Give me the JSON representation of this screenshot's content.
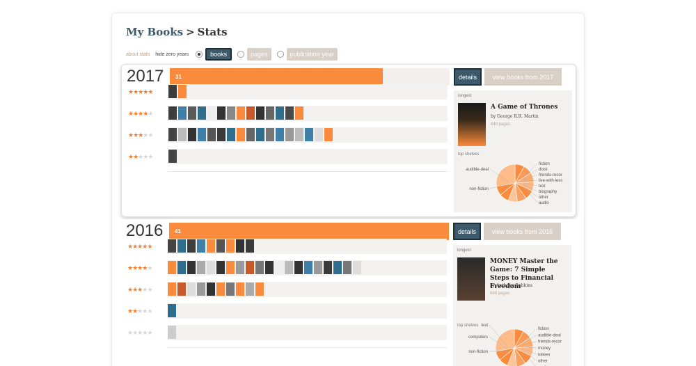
{
  "header": {
    "title_part1": "My Books",
    "title_sep": ">",
    "title_part2": "Stats"
  },
  "controls": {
    "about": "about stats",
    "hide": "hide zero years",
    "toggles": [
      {
        "label": "books",
        "selected": true
      },
      {
        "label": "pages",
        "selected": false
      },
      {
        "label": "publication year",
        "selected": false
      }
    ]
  },
  "colors": {
    "accent": "#fa8b3c",
    "nav": "#3d5a6b",
    "muted": "#d8cfc6"
  },
  "years": [
    {
      "year": "2017",
      "count": "31",
      "fill_fraction": 0.76,
      "details_label": "details",
      "view_label": "view books from 2017",
      "ratings": [
        {
          "stars": 5,
          "covers": [
            "#3d3d3d",
            "#fa8b3c"
          ]
        },
        {
          "stars": 4,
          "covers": [
            "#3d3d3d",
            "#3f7fa8",
            "#5a5a5a",
            "#2e6d8c",
            "#eee",
            "#333",
            "#888",
            "#fa8b3c",
            "#c85a2a",
            "#333",
            "#666",
            "#2e6d8c",
            "#4a4a4a",
            "#fa8b3c"
          ]
        },
        {
          "stars": 3,
          "covers": [
            "#444",
            "#bbb",
            "#333",
            "#3f7fa8",
            "#555",
            "#3a3a3a",
            "#2e6d8c",
            "#fa8b3c",
            "#666",
            "#2e6d8c",
            "#777",
            "#3f7fa8",
            "#999",
            "#bbb",
            "#3f7fa8",
            "#ddd",
            "#fa8b3c"
          ]
        },
        {
          "stars": 2,
          "covers": [
            "#444"
          ]
        }
      ],
      "longest_label": "longest",
      "longest": {
        "title": "A Game of Thrones",
        "author": "by George R.R. Martin",
        "pages": "848 pages"
      },
      "top_shelves_label": "top shelves",
      "shelves_left": [
        "audible-deal",
        "non-fiction"
      ],
      "shelves_right": [
        "fiction",
        "doist",
        "friends-recor",
        "live-with-less",
        "text",
        "biography",
        "other",
        "audio"
      ]
    },
    {
      "year": "2016",
      "count": "41",
      "fill_fraction": 1.0,
      "details_label": "details",
      "view_label": "view books from 2016",
      "ratings": [
        {
          "stars": 5,
          "covers": [
            "#444",
            "#2e6d8c",
            "#3d3d3d",
            "#3f7fa8",
            "#fa8b3c",
            "#555",
            "#fa8b3c",
            "#333",
            "#3a3a3a"
          ]
        },
        {
          "stars": 4,
          "covers": [
            "#fa8b3c",
            "#2e6d8c",
            "#333",
            "#aaa",
            "#ddd",
            "#333",
            "#fa8b3c",
            "#999",
            "#c85a2a",
            "#777",
            "#333",
            "#eee",
            "#bbb",
            "#333",
            "#3f7fa8",
            "#999",
            "#3a3a3a",
            "#2e6d8c",
            "#777",
            "#ddd"
          ]
        },
        {
          "stars": 3,
          "covers": [
            "#fa8b3c",
            "#c85a2a",
            "#ddd",
            "#999",
            "#333",
            "#fa8b3c",
            "#777",
            "#fa8b3c",
            "#aaa",
            "#fa8b3c"
          ]
        },
        {
          "stars": 2,
          "covers": [
            "#2e6d8c"
          ]
        },
        {
          "stars": 0,
          "covers": [
            "#ccc"
          ]
        }
      ],
      "longest_label": "longest",
      "longest": {
        "title": "MONEY Master the Game: 7 Simple Steps to Financial Freedom",
        "author": "by Anthony Robbins",
        "pages": "688 pages"
      },
      "top_shelves_label": "top shelves",
      "shelves_left": [
        "text",
        "computers",
        "non-fiction"
      ],
      "shelves_right": [
        "fiction",
        "audible-deal",
        "friends-recor",
        "money",
        "tolkien",
        "other",
        "audio"
      ]
    }
  ]
}
